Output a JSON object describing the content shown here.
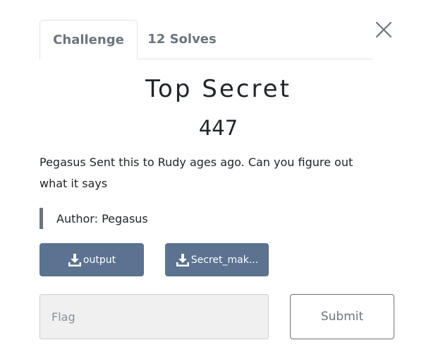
{
  "tabs": {
    "challenge_label": "Challenge",
    "solves_label": "12 Solves"
  },
  "challenge": {
    "name": "Top Secret",
    "points": "447",
    "description": "Pegasus Sent this to Rudy ages ago. Can you figure out what it says",
    "author": "Author: Pegasus"
  },
  "files": [
    {
      "label": "output",
      "icon": "download-icon"
    },
    {
      "label": "Secret_mak...",
      "icon": "download-icon"
    }
  ],
  "flag": {
    "placeholder": "Flag",
    "value": ""
  },
  "submit_label": "Submit",
  "icons": {
    "close": "close-icon"
  },
  "colors": {
    "file_button": "#5b7290",
    "input_background": "#f0f0f0",
    "muted": "#6c757d"
  }
}
